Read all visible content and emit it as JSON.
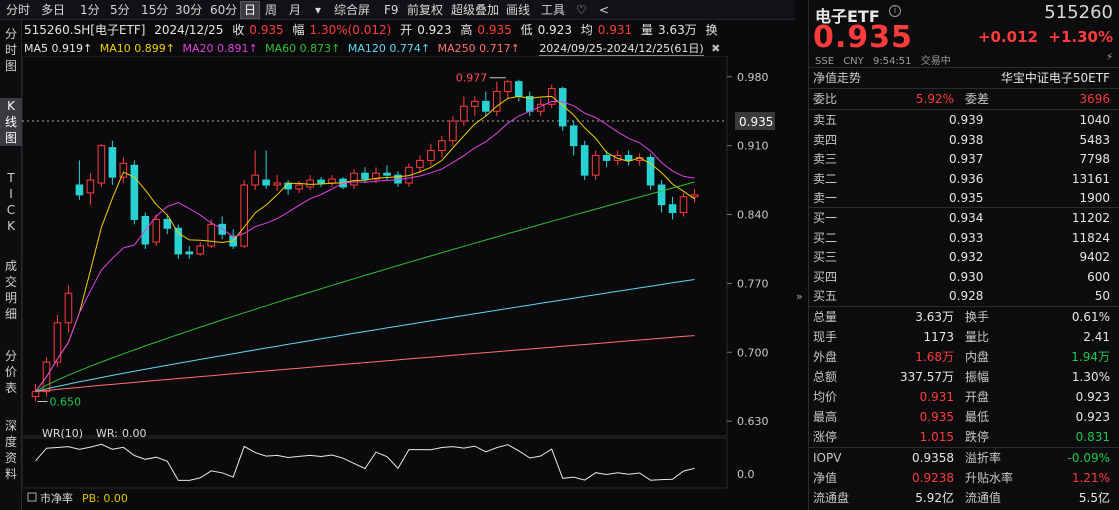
{
  "toolbar": {
    "items": [
      "分时",
      "多日",
      "1分",
      "5分",
      "15分",
      "30分",
      "60分",
      "日",
      "周",
      "月",
      "▾",
      "综合屏",
      "F9",
      "前复权",
      "超级叠加",
      "画线",
      "工具",
      "♡",
      "<"
    ],
    "active_index": 7
  },
  "left_tabs": [
    "分\n时\n图",
    "K\n线\n图",
    "T\nI\nC\nK",
    "成\n交\n明\n细",
    "分\n价\n表",
    "深\n度\n资\n料"
  ],
  "info": {
    "symbol": "515260.SH[电子ETF]",
    "date": "2024/12/25",
    "close_label": "收",
    "close": "0.935",
    "amp_label": "幅",
    "amp": "1.30%(0.012)",
    "open_label": "开",
    "open": "0.923",
    "high_label": "高",
    "high": "0.935",
    "low_label": "低",
    "low": "0.923",
    "avg_label": "均",
    "avg": "0.931",
    "vol_label": "量",
    "vol": "3.63万",
    "turn_label": "换"
  },
  "ma_line": {
    "ma5": "MA5 0.919↑",
    "ma10": "MA10 0.899↑",
    "ma20": "MA20 0.891↑",
    "ma60": "MA60 0.873↑",
    "ma120": "MA120 0.774↑",
    "ma250": "MA250 0.717↑",
    "range": "2024/09/25-2024/12/25(61日)",
    "colors": {
      "ma5": "#e8e8e8",
      "ma10": "#f0d000",
      "ma20": "#e040e0",
      "ma60": "#30c030",
      "ma120": "#60d8f0",
      "ma250": "#ff7070"
    }
  },
  "chart_data": {
    "type": "candlestick",
    "ylim": [
      0.62,
      0.995
    ],
    "yticks": [
      "0.980",
      "0.910",
      "0.840",
      "0.770",
      "0.700",
      "0.630"
    ],
    "ytick_values": [
      0.98,
      0.91,
      0.84,
      0.77,
      0.7,
      0.63
    ],
    "last_price": "0.935",
    "last_price_value": 0.935,
    "max_label": "0.977",
    "max_value": 0.977,
    "min_label": "0.650",
    "min_value": 0.65,
    "candles": [
      [
        0.655,
        0.66,
        0.65,
        0.668
      ],
      [
        0.66,
        0.69,
        0.655,
        0.695
      ],
      [
        0.69,
        0.73,
        0.685,
        0.738
      ],
      [
        0.73,
        0.76,
        0.72,
        0.768
      ],
      [
        0.87,
        0.86,
        0.855,
        0.895
      ],
      [
        0.862,
        0.875,
        0.85,
        0.882
      ],
      [
        0.872,
        0.91,
        0.868,
        0.912
      ],
      [
        0.908,
        0.878,
        0.87,
        0.915
      ],
      [
        0.878,
        0.892,
        0.872,
        0.898
      ],
      [
        0.89,
        0.835,
        0.83,
        0.895
      ],
      [
        0.838,
        0.81,
        0.805,
        0.842
      ],
      [
        0.812,
        0.835,
        0.808,
        0.84
      ],
      [
        0.835,
        0.826,
        0.82,
        0.84
      ],
      [
        0.826,
        0.8,
        0.795,
        0.83
      ],
      [
        0.802,
        0.8,
        0.795,
        0.808
      ],
      [
        0.8,
        0.808,
        0.798,
        0.812
      ],
      [
        0.808,
        0.83,
        0.806,
        0.835
      ],
      [
        0.83,
        0.82,
        0.815,
        0.838
      ],
      [
        0.818,
        0.808,
        0.805,
        0.825
      ],
      [
        0.808,
        0.87,
        0.806,
        0.875
      ],
      [
        0.87,
        0.88,
        0.865,
        0.905
      ],
      [
        0.875,
        0.87,
        0.866,
        0.905
      ],
      [
        0.87,
        0.872,
        0.864,
        0.88
      ],
      [
        0.872,
        0.866,
        0.86,
        0.875
      ],
      [
        0.866,
        0.87,
        0.862,
        0.874
      ],
      [
        0.868,
        0.875,
        0.865,
        0.88
      ],
      [
        0.875,
        0.872,
        0.868,
        0.878
      ],
      [
        0.872,
        0.876,
        0.868,
        0.88
      ],
      [
        0.876,
        0.868,
        0.866,
        0.878
      ],
      [
        0.87,
        0.882,
        0.866,
        0.886
      ],
      [
        0.882,
        0.876,
        0.872,
        0.888
      ],
      [
        0.876,
        0.882,
        0.872,
        0.888
      ],
      [
        0.882,
        0.88,
        0.875,
        0.89
      ],
      [
        0.88,
        0.872,
        0.868,
        0.884
      ],
      [
        0.872,
        0.888,
        0.868,
        0.892
      ],
      [
        0.888,
        0.895,
        0.882,
        0.9
      ],
      [
        0.895,
        0.905,
        0.89,
        0.912
      ],
      [
        0.905,
        0.915,
        0.898,
        0.92
      ],
      [
        0.915,
        0.935,
        0.91,
        0.94
      ],
      [
        0.935,
        0.95,
        0.93,
        0.96
      ],
      [
        0.95,
        0.955,
        0.94,
        0.96
      ],
      [
        0.955,
        0.945,
        0.94,
        0.965
      ],
      [
        0.945,
        0.965,
        0.94,
        0.975
      ],
      [
        0.965,
        0.975,
        0.958,
        0.977
      ],
      [
        0.975,
        0.96,
        0.955,
        0.977
      ],
      [
        0.96,
        0.945,
        0.94,
        0.965
      ],
      [
        0.945,
        0.952,
        0.94,
        0.958
      ],
      [
        0.952,
        0.968,
        0.948,
        0.972
      ],
      [
        0.968,
        0.93,
        0.925,
        0.97
      ],
      [
        0.93,
        0.91,
        0.9,
        0.935
      ],
      [
        0.91,
        0.88,
        0.875,
        0.915
      ],
      [
        0.88,
        0.9,
        0.875,
        0.905
      ],
      [
        0.9,
        0.895,
        0.888,
        0.905
      ],
      [
        0.895,
        0.9,
        0.89,
        0.905
      ],
      [
        0.9,
        0.895,
        0.89,
        0.905
      ],
      [
        0.895,
        0.898,
        0.89,
        0.902
      ],
      [
        0.898,
        0.87,
        0.865,
        0.902
      ],
      [
        0.87,
        0.85,
        0.842,
        0.875
      ],
      [
        0.85,
        0.842,
        0.835,
        0.858
      ],
      [
        0.842,
        0.858,
        0.838,
        0.862
      ],
      [
        0.858,
        0.86,
        0.852,
        0.866
      ]
    ],
    "candle_order_note": "",
    "ma5": [],
    "wr_label": "WR(10)",
    "wr_value_label": "WR:",
    "wr_value": "0.00",
    "wr_ytick": "0.0",
    "pb_label": "市净率",
    "pb_value": "PB: 0.00"
  },
  "quote": {
    "title": "电子ETF",
    "code": "515260",
    "price": "0.935",
    "change": "+0.012",
    "change_pct": "+1.30%",
    "market": "SSE",
    "currency": "CNY",
    "time": "9:54:51",
    "status": "交易中",
    "nav_label": "净值走势",
    "index_name": "华宝中证电子50ETF",
    "wei_bi_label": "委比",
    "wei_bi": "5.92%",
    "wei_cha_label": "委差",
    "wei_cha": "3696",
    "asks": [
      {
        "label": "卖五",
        "price": "0.939",
        "vol": "1040"
      },
      {
        "label": "卖四",
        "price": "0.938",
        "vol": "5483"
      },
      {
        "label": "卖三",
        "price": "0.937",
        "vol": "7798"
      },
      {
        "label": "卖二",
        "price": "0.936",
        "vol": "13161"
      },
      {
        "label": "卖一",
        "price": "0.935",
        "vol": "1900"
      }
    ],
    "bids": [
      {
        "label": "买一",
        "price": "0.934",
        "vol": "11202"
      },
      {
        "label": "买二",
        "price": "0.933",
        "vol": "11824"
      },
      {
        "label": "买三",
        "price": "0.932",
        "vol": "9402"
      },
      {
        "label": "买四",
        "price": "0.930",
        "vol": "600"
      },
      {
        "label": "买五",
        "price": "0.928",
        "vol": "50"
      }
    ],
    "stats": [
      [
        {
          "l": "总量",
          "v": "3.63万",
          "c": "white"
        },
        {
          "l": "换手",
          "v": "0.61%",
          "c": "white"
        }
      ],
      [
        {
          "l": "现手",
          "v": "1173",
          "c": "white"
        },
        {
          "l": "量比",
          "v": "2.41",
          "c": "white"
        }
      ],
      [
        {
          "l": "外盘",
          "v": "1.68万",
          "c": "red"
        },
        {
          "l": "内盘",
          "v": "1.94万",
          "c": "green"
        }
      ],
      [
        {
          "l": "总额",
          "v": "337.57万",
          "c": "white"
        },
        {
          "l": "振幅",
          "v": "1.30%",
          "c": "white"
        }
      ],
      [
        {
          "l": "均价",
          "v": "0.931",
          "c": "red"
        },
        {
          "l": "开盘",
          "v": "0.923",
          "c": "white"
        }
      ],
      [
        {
          "l": "最高",
          "v": "0.935",
          "c": "red"
        },
        {
          "l": "最低",
          "v": "0.923",
          "c": "white"
        }
      ],
      [
        {
          "l": "涨停",
          "v": "1.015",
          "c": "red"
        },
        {
          "l": "跌停",
          "v": "0.831",
          "c": "green"
        }
      ]
    ],
    "stats2": [
      [
        {
          "l": "IOPV",
          "v": "0.9358",
          "c": "white"
        },
        {
          "l": "溢折率",
          "v": "-0.09%",
          "c": "green"
        }
      ],
      [
        {
          "l": "净值",
          "v": "0.9238",
          "c": "red"
        },
        {
          "l": "升贴水率",
          "v": "1.21%",
          "c": "red"
        }
      ],
      [
        {
          "l": "流通盘",
          "v": "5.92亿",
          "c": "white"
        },
        {
          "l": "流通值",
          "v": "5.5亿",
          "c": "white"
        }
      ]
    ]
  }
}
